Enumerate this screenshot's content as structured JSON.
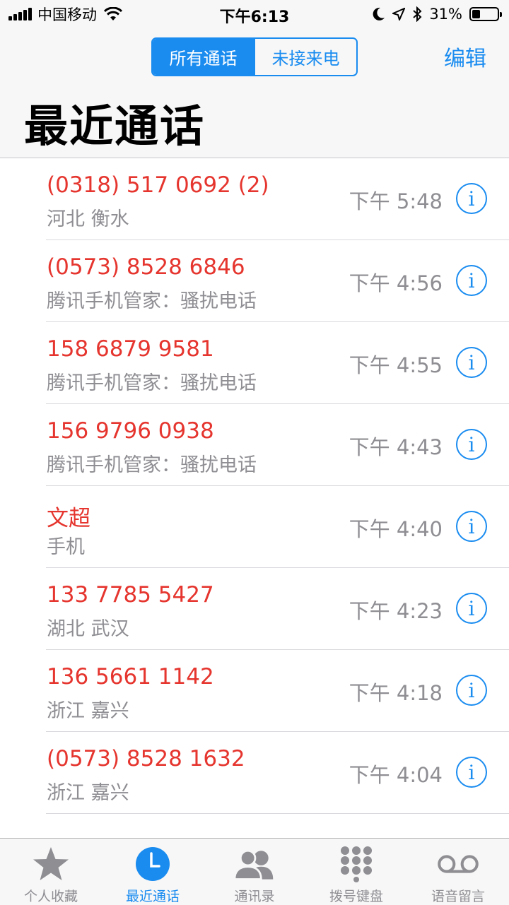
{
  "status_bar": {
    "carrier": "中国移动",
    "time": "下午6:13",
    "battery": "31%",
    "battery_level": 0.31
  },
  "header": {
    "segments": [
      "所有通话",
      "未接来电"
    ],
    "active_segment": 0,
    "edit": "编辑",
    "title": "最近通话"
  },
  "calls": [
    {
      "name": "(0318) 517 0692 (2)",
      "sub": "河北 衡水",
      "time": "下午 5:48"
    },
    {
      "name": "(0573) 8528 6846",
      "sub": "腾讯手机管家：骚扰电话",
      "time": "下午 4:56"
    },
    {
      "name": "158 6879 9581",
      "sub": "腾讯手机管家：骚扰电话",
      "time": "下午 4:55"
    },
    {
      "name": "156 9796 0938",
      "sub": "腾讯手机管家：骚扰电话",
      "time": "下午 4:43"
    },
    {
      "name": "文超",
      "sub": "手机",
      "time": "下午 4:40"
    },
    {
      "name": "133 7785 5427",
      "sub": "湖北 武汉",
      "time": "下午 4:23"
    },
    {
      "name": "136 5661 1142",
      "sub": "浙江 嘉兴",
      "time": "下午 4:18"
    },
    {
      "name": "(0573) 8528 1632",
      "sub": "浙江 嘉兴",
      "time": "下午 4:04"
    }
  ],
  "tabs": [
    {
      "label": "个人收藏",
      "icon": "star-icon"
    },
    {
      "label": "最近通话",
      "icon": "clock-icon"
    },
    {
      "label": "通讯录",
      "icon": "contacts-icon"
    },
    {
      "label": "拨号键盘",
      "icon": "keypad-icon"
    },
    {
      "label": "语音留言",
      "icon": "voicemail-icon"
    }
  ],
  "active_tab": 1,
  "colors": {
    "accent": "#1a8cf0",
    "missed": "#e5352e",
    "secondary_text": "#8e8e93"
  }
}
